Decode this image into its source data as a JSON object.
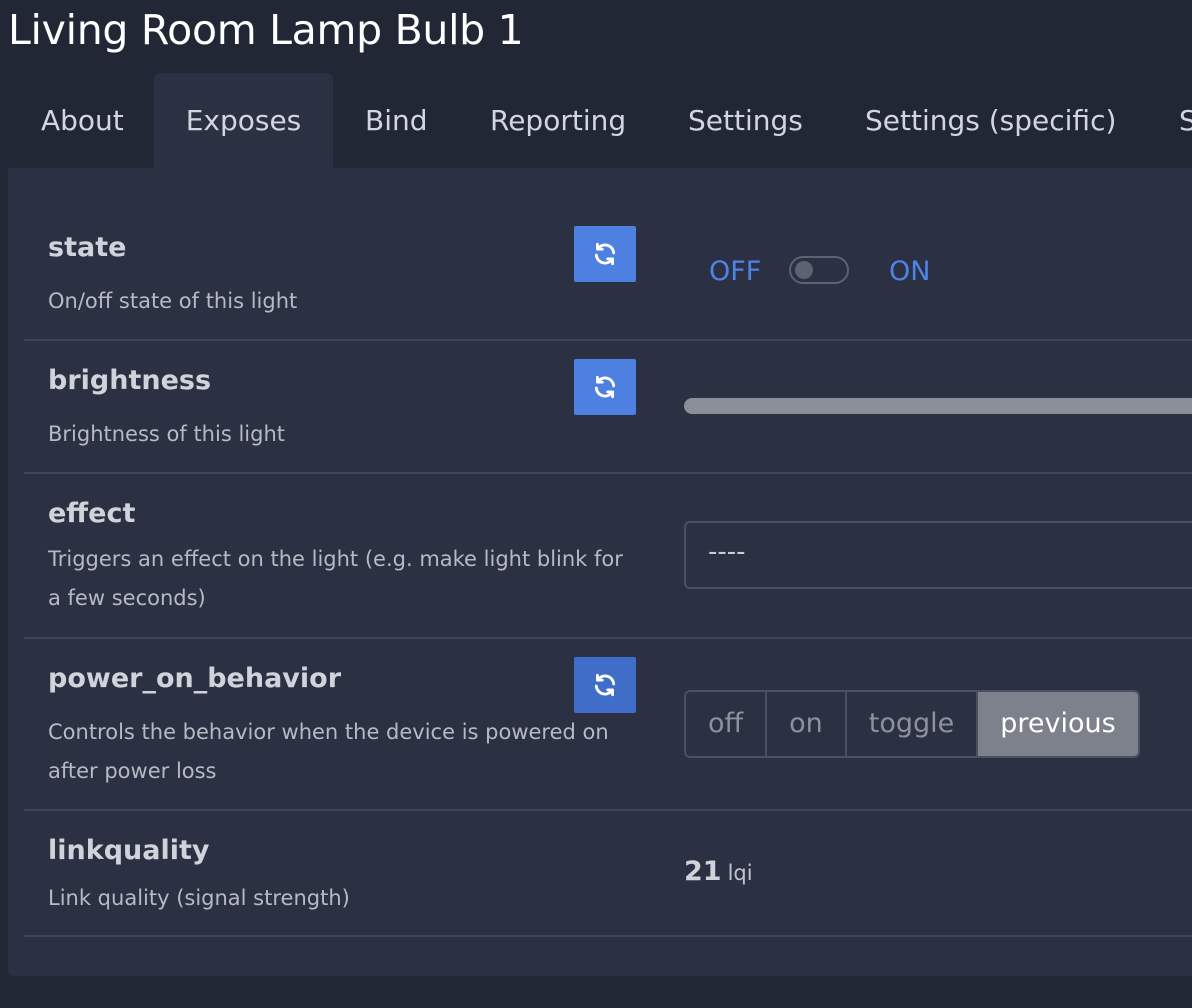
{
  "page": {
    "title": "Living Room Lamp Bulb 1"
  },
  "tabs": [
    {
      "label": "About"
    },
    {
      "label": "Exposes",
      "active": true
    },
    {
      "label": "Bind"
    },
    {
      "label": "Reporting"
    },
    {
      "label": "Settings"
    },
    {
      "label": "Settings (specific)"
    },
    {
      "label": "S"
    }
  ],
  "exposes": {
    "state": {
      "name": "state",
      "description": "On/off state of this light",
      "off_label": "OFF",
      "on_label": "ON",
      "value": "OFF"
    },
    "brightness": {
      "name": "brightness",
      "description": "Brightness of this light"
    },
    "effect": {
      "name": "effect",
      "description": "Triggers an effect on the light (e.g. make light blink for a few seconds)",
      "selected": "----"
    },
    "power_on_behavior": {
      "name": "power_on_behavior",
      "description": "Controls the behavior when the device is powered on after power loss",
      "options": [
        "off",
        "on",
        "toggle",
        "previous"
      ],
      "selected": "previous"
    },
    "linkquality": {
      "name": "linkquality",
      "description": "Link quality (signal strength)",
      "value": "21",
      "unit": "lqi"
    }
  },
  "icons": {
    "refresh": "refresh-icon"
  },
  "colors": {
    "accent": "#4e80e2",
    "background": "#222736",
    "panel": "#2b3042",
    "selected_option": "#7d818c"
  }
}
